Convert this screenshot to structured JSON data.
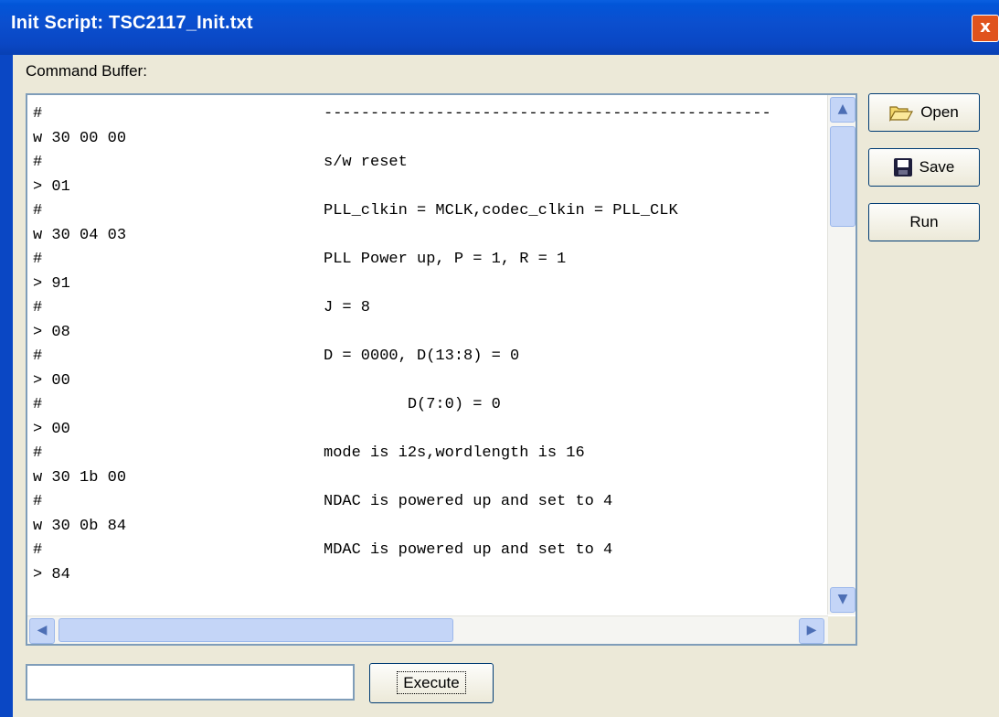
{
  "window": {
    "title": "Init Script: TSC2117_Init.txt",
    "close_label": "x"
  },
  "command_buffer_label": "Command Buffer:",
  "lines": [
    {
      "cmd": "#",
      "comment": "------------------------------------------------"
    },
    {
      "cmd": "w 30 00 00",
      "comment": ""
    },
    {
      "cmd": "#",
      "comment": "s/w reset"
    },
    {
      "cmd": "> 01",
      "comment": ""
    },
    {
      "cmd": "#",
      "comment": "PLL_clkin = MCLK,codec_clkin = PLL_CLK"
    },
    {
      "cmd": "w 30 04 03",
      "comment": ""
    },
    {
      "cmd": "#",
      "comment": "PLL Power up, P = 1, R = 1"
    },
    {
      "cmd": "> 91",
      "comment": ""
    },
    {
      "cmd": "#",
      "comment": "J = 8"
    },
    {
      "cmd": "> 08",
      "comment": ""
    },
    {
      "cmd": "#",
      "comment": "D = 0000, D(13:8) = 0"
    },
    {
      "cmd": "> 00",
      "comment": ""
    },
    {
      "cmd": "#",
      "comment": "         D(7:0) = 0"
    },
    {
      "cmd": "> 00",
      "comment": ""
    },
    {
      "cmd": "#",
      "comment": "mode is i2s,wordlength is 16"
    },
    {
      "cmd": "w 30 1b 00",
      "comment": ""
    },
    {
      "cmd": "#",
      "comment": "NDAC is powered up and set to 4"
    },
    {
      "cmd": "w 30 0b 84",
      "comment": ""
    },
    {
      "cmd": "#",
      "comment": "MDAC is powered up and set to 4"
    },
    {
      "cmd": "> 84",
      "comment": ""
    }
  ],
  "buttons": {
    "open": "Open",
    "save": "Save",
    "run": "Run",
    "execute": "Execute"
  },
  "execute_input_value": "",
  "colors": {
    "titlebar": "#0a47c4",
    "window_bg": "#ece9d8",
    "close": "#e0531d"
  }
}
